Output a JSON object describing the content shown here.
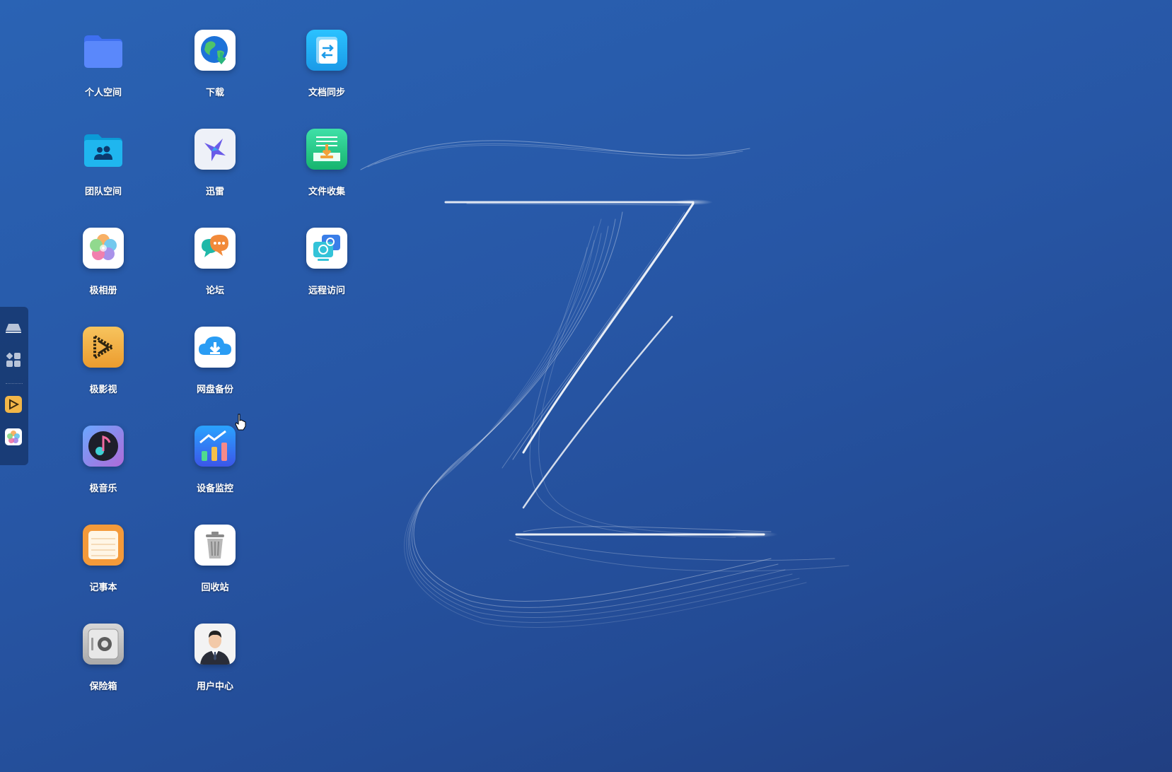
{
  "desktop": {
    "apps": [
      {
        "label": "个人空间",
        "icon": "folder-icon"
      },
      {
        "label": "下载",
        "icon": "globe-download-icon"
      },
      {
        "label": "文档同步",
        "icon": "sync-icon"
      },
      {
        "label": "团队空间",
        "icon": "team-folder-icon"
      },
      {
        "label": "迅雷",
        "icon": "thunder-bird-icon"
      },
      {
        "label": "文件收集",
        "icon": "file-collect-icon"
      },
      {
        "label": "极相册",
        "icon": "photo-flower-icon"
      },
      {
        "label": "论坛",
        "icon": "forum-chat-icon"
      },
      {
        "label": "远程访问",
        "icon": "remote-access-icon"
      },
      {
        "label": "极影视",
        "icon": "video-play-icon"
      },
      {
        "label": "网盘备份",
        "icon": "cloud-backup-icon"
      },
      {
        "label": "极音乐",
        "icon": "music-note-icon"
      },
      {
        "label": "设备监控",
        "icon": "monitor-chart-icon"
      },
      {
        "label": "记事本",
        "icon": "notepad-icon"
      },
      {
        "label": "回收站",
        "icon": "trash-icon"
      },
      {
        "label": "保险箱",
        "icon": "safe-icon"
      },
      {
        "label": "用户中心",
        "icon": "user-avatar-icon"
      }
    ]
  },
  "dock": {
    "items": [
      "show-desktop-icon",
      "app-grid-icon",
      "video-play-icon",
      "photo-flower-icon"
    ]
  },
  "colors": {
    "background": "#2756a5",
    "label": "#ffffff",
    "dock": "#163469"
  }
}
